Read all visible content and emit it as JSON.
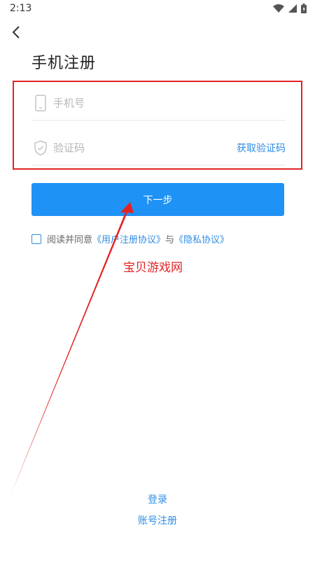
{
  "status_bar": {
    "time": "2:13"
  },
  "header": {
    "title": "手机注册"
  },
  "form": {
    "phone_placeholder": "手机号",
    "code_placeholder": "验证码",
    "get_code_label": "获取验证码"
  },
  "next_button": {
    "label": "下一步"
  },
  "agreement": {
    "prefix": "阅读并同意",
    "user_agreement": "《用户注册协议》",
    "joiner": "与",
    "privacy_agreement": "《隐私协议》"
  },
  "watermark": {
    "text": "宝贝游戏网"
  },
  "footer": {
    "login_label": "登录",
    "account_register_label": "账号注册"
  },
  "colors": {
    "accent": "#1f92f5",
    "link": "#2f8de4",
    "annotation": "#e32323"
  }
}
